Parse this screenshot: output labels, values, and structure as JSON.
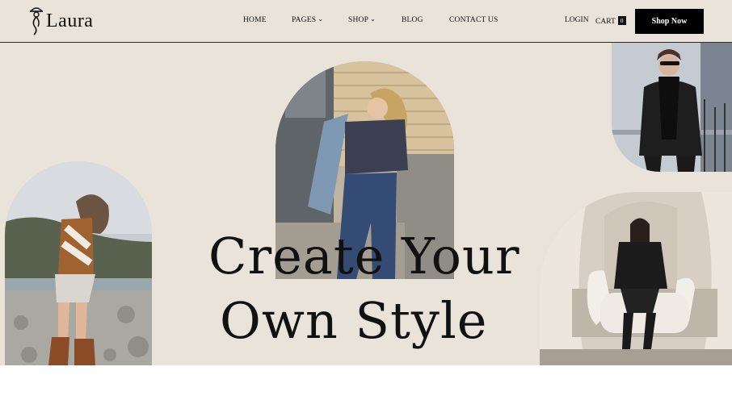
{
  "brand": {
    "name": "Laura"
  },
  "nav": {
    "home": "HOME",
    "pages": "PAGES",
    "shop": "SHOP",
    "blog": "BLOG",
    "contact": "CONTACT US",
    "dropdown_glyph": "⌄"
  },
  "header_right": {
    "login": "LOGIN",
    "cart": "CART",
    "cart_count": "0",
    "shop_now": "Shop Now"
  },
  "hero": {
    "headline_line1": "Create Your",
    "headline_line2": "Own Style"
  },
  "colors": {
    "background": "#e9e3da",
    "text": "#111111",
    "button": "#000000"
  }
}
